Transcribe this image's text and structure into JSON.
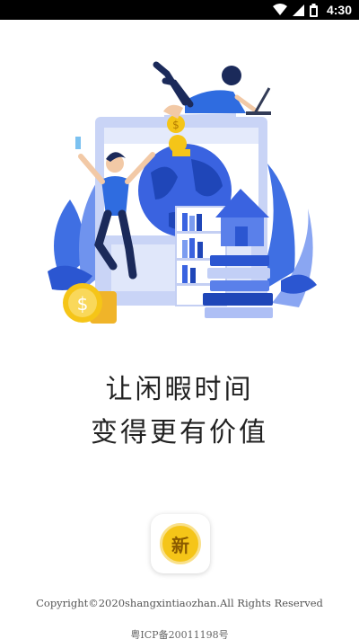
{
  "status_bar": {
    "time": "4:30",
    "icons": [
      "wifi-icon",
      "signal-icon",
      "battery-icon"
    ]
  },
  "illustration": {
    "coin_symbol": "$"
  },
  "slogan": {
    "line1": "让闲暇时间",
    "line2": "变得更有价值"
  },
  "app_icon": {
    "glyph": "新"
  },
  "footer": {
    "copyright": "Copyright©2020shangxintiaozhan.All Rights Reserved",
    "icp": "粤ICP备20011198号"
  },
  "colors": {
    "primary_blue": "#3a63e0",
    "light_blue": "#aebff5",
    "coin_gold": "#f5c518",
    "text_dark": "#222222"
  }
}
